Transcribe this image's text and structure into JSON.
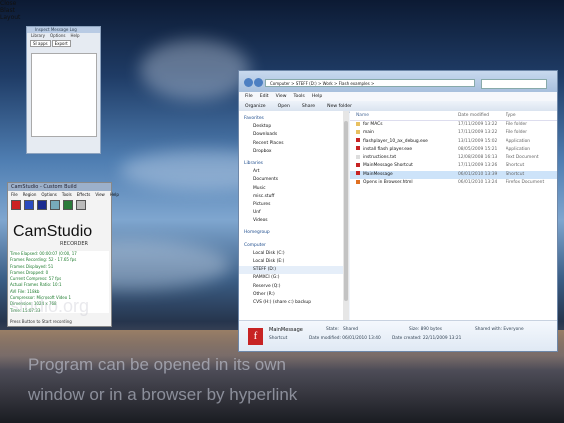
{
  "dialog": {
    "title": "Inspect Message Log",
    "menu": [
      "Library",
      "Options",
      "Help"
    ],
    "tabs": [
      "SI apps",
      "Export"
    ],
    "close_label": "Close",
    "resize_label": "Blast Layout"
  },
  "camstudio": {
    "title": "CamStudio - Custom Build",
    "menu": [
      "File",
      "Region",
      "Options",
      "Tools",
      "Effects",
      "View",
      "Help"
    ],
    "logo": "CamStudio",
    "recorder": "RECORDER",
    "stats": [
      "Time Elapsed: 00:00:07 (0:00, 17",
      "Frames Recording: 52 - 17.65 fps",
      "Frames Displayed: 51",
      "Frames Dropped: 0",
      "Current Compress: 57 fps",
      "Actual Frames Ratio: 10:1",
      "AVI File: 118kb",
      "Compressor: Microsoft Video 1",
      "Dimension: 1024 x 768",
      "Time: 15:07:33"
    ],
    "status": "Press Button to Start recording"
  },
  "explorer": {
    "address": "Computer > STEFF (D:) > Work > Flash examples >",
    "menu": [
      "File",
      "Edit",
      "View",
      "Tools",
      "Help"
    ],
    "commands": [
      "Organize",
      "Open",
      "Share",
      "New folder"
    ],
    "nav_groups": [
      {
        "title": "Favorites",
        "items": [
          "Desktop",
          "Downloads",
          "Recent Places",
          "Dropbox"
        ]
      },
      {
        "title": "Libraries",
        "items": [
          "Art",
          "Documents",
          "Music",
          "misc.stuff",
          "Pictures",
          "Unf",
          "Videos"
        ]
      },
      {
        "title": "Homegroup",
        "items": []
      },
      {
        "title": "Computer",
        "items": [
          "Local Disk (C:)",
          "Local Disk (E:)",
          "STEFF (D:)",
          "RAMXCI (G:)",
          "Reserve (Q:)",
          "Other (R:)",
          "CVS (H:) (share c:) backup"
        ]
      }
    ],
    "columns": [
      "Name",
      "Date modified",
      "Type"
    ],
    "files": [
      {
        "name": "for MACs",
        "date": "17/11/2009 13:22",
        "type": "File folder",
        "color": "#e8c060"
      },
      {
        "name": "main",
        "date": "17/11/2009 13:22",
        "type": "File folder",
        "color": "#e8c060"
      },
      {
        "name": "flashplayer_10_ax_debug.exe",
        "date": "13/11/2009 15:02",
        "type": "Application",
        "color": "#c72323"
      },
      {
        "name": "install flash player.exe",
        "date": "08/05/2009 15:21",
        "type": "Application",
        "color": "#c72323"
      },
      {
        "name": "instructions.txt",
        "date": "12/08/2008 16:13",
        "type": "Text Document",
        "color": "#dddddd"
      },
      {
        "name": "MainMessage Shortcut",
        "date": "17/11/2009 13:26",
        "type": "Shortcut",
        "color": "#c72323"
      },
      {
        "name": "MainMessage",
        "date": "06/01/2010 13:39",
        "type": "Shortcut",
        "color": "#c72323"
      },
      {
        "name": "Opens in Browser.html",
        "date": "06/01/2010 13:24",
        "type": "Firefox Document",
        "color": "#e07020"
      }
    ],
    "selected_index": 6,
    "details": {
      "name": "MainMessage",
      "kind": "Shortcut",
      "modified": "Date modified: 06/01/2010 13:40",
      "state_label": "State:",
      "state": "Shared",
      "size": "Size: 890 bytes",
      "created": "Date created: 22/11/2009 13:21",
      "shared_label": "Shared with: Everyone"
    }
  },
  "watermark": "studio.org",
  "caption": {
    "line1": "Program can be opened in its own",
    "line2": "window or in a browser by hyperlink"
  }
}
